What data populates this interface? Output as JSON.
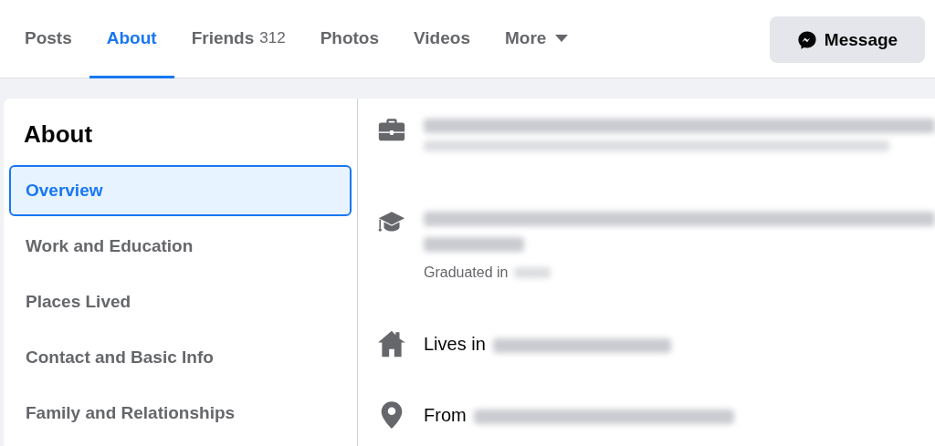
{
  "tabs": [
    {
      "label": "Posts",
      "selected": false
    },
    {
      "label": "About",
      "selected": true
    },
    {
      "label": "Friends",
      "count": "312",
      "selected": false
    },
    {
      "label": "Photos",
      "selected": false
    },
    {
      "label": "Videos",
      "selected": false
    },
    {
      "label": "More",
      "dropdown": true,
      "selected": false
    }
  ],
  "message_button": {
    "label": "Message"
  },
  "about": {
    "title": "About",
    "sections": [
      {
        "label": "Overview",
        "selected": true
      },
      {
        "label": "Work and Education",
        "selected": false
      },
      {
        "label": "Places Lived",
        "selected": false
      },
      {
        "label": "Contact and Basic Info",
        "selected": false
      },
      {
        "label": "Family and Relationships",
        "selected": false
      }
    ]
  },
  "overview": [
    {
      "kind": "work"
    },
    {
      "kind": "education",
      "detail": "Graduated in"
    },
    {
      "kind": "home",
      "label": "Lives in"
    },
    {
      "kind": "place",
      "label": "From"
    }
  ]
}
